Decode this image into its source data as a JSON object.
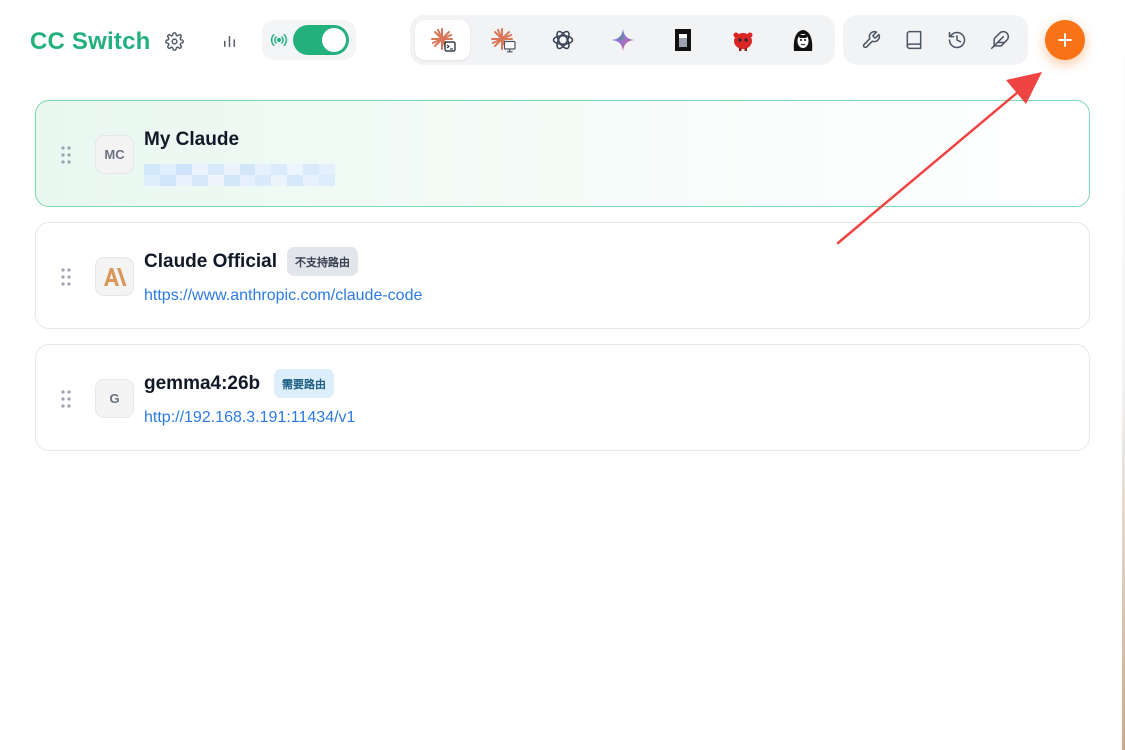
{
  "app": {
    "title": "CC Switch"
  },
  "header": {
    "settings_icon": "gear-icon",
    "stats_icon": "bar-chart-icon",
    "proxy": {
      "icon": "broadcast-icon",
      "enabled": true
    }
  },
  "app_tabs": [
    {
      "name": "claude-code",
      "icon": "claude-terminal-icon",
      "active": true
    },
    {
      "name": "claude-desktop",
      "icon": "claude-desktop-icon",
      "active": false
    },
    {
      "name": "openai-codex",
      "icon": "openai-icon",
      "active": false
    },
    {
      "name": "gemini",
      "icon": "gemini-icon",
      "active": false
    },
    {
      "name": "opencode",
      "icon": "opencode-icon",
      "active": false
    },
    {
      "name": "mascot-app",
      "icon": "red-mascot-icon",
      "active": false
    },
    {
      "name": "character-app",
      "icon": "character-icon",
      "active": false
    }
  ],
  "tools": [
    {
      "name": "tools",
      "icon": "wrench-icon"
    },
    {
      "name": "prompts",
      "icon": "book-icon"
    },
    {
      "name": "history",
      "icon": "history-icon"
    },
    {
      "name": "skills",
      "icon": "feather-icon"
    }
  ],
  "add_button": {
    "icon": "plus-icon"
  },
  "providers": [
    {
      "name": "My Claude",
      "avatar": "MC",
      "active": true,
      "url_redacted": true,
      "badge": null,
      "url": ""
    },
    {
      "name": "Claude Official",
      "avatar_icon": "anthropic-logo-icon",
      "active": false,
      "badge": "不支持路由",
      "url": "https://www.anthropic.com/claude-code"
    },
    {
      "name": "gemma4:26b",
      "avatar": "G",
      "active": false,
      "badge": "需要路由",
      "url": "http://192.168.3.191:11434/v1"
    }
  ],
  "colors": {
    "brand_green": "#22b07d",
    "accent_orange": "#f97316",
    "link_blue": "#2c7be5",
    "annotation_red": "#ef4444"
  }
}
